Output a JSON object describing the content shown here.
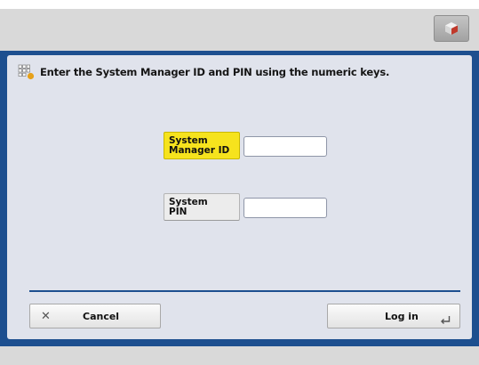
{
  "instruction": {
    "text": "Enter the System Manager ID and PIN using the numeric keys.",
    "icon": "keypad-info-icon"
  },
  "fields": {
    "manager_id": {
      "label_line1": "System",
      "label_line2": "Manager ID",
      "value": "",
      "selected": true
    },
    "pin": {
      "label_line1": "System",
      "label_line2": "PIN",
      "value": ""
    }
  },
  "buttons": {
    "cancel": {
      "label": "Cancel",
      "icon": "close-icon"
    },
    "login": {
      "label": "Log in",
      "icon": "enter-return-icon"
    }
  },
  "topbar": {
    "icon": "cube-icon"
  },
  "colors": {
    "frame": "#1d4f8f",
    "panel": "#e0e3ec",
    "selected_label": "#f6e31d"
  }
}
